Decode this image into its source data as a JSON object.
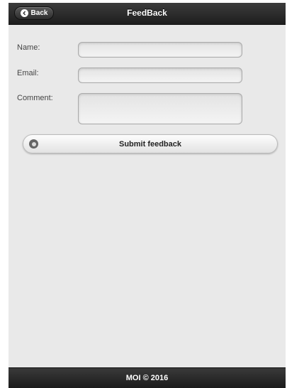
{
  "header": {
    "back_label": "Back",
    "title": "FeedBack"
  },
  "form": {
    "name_label": "Name:",
    "name_value": "",
    "email_label": "Email:",
    "email_value": "",
    "comment_label": "Comment:",
    "comment_value": "",
    "submit_label": "Submit feedback"
  },
  "footer": {
    "text": "MOI © 2016"
  },
  "icons": {
    "back": "chevron-left-icon",
    "submit": "radio-circle-icon"
  },
  "colors": {
    "bar_bg": "#1e1e1e",
    "page_bg": "#e9e9e9",
    "button_bg": "#f5f5f5"
  }
}
